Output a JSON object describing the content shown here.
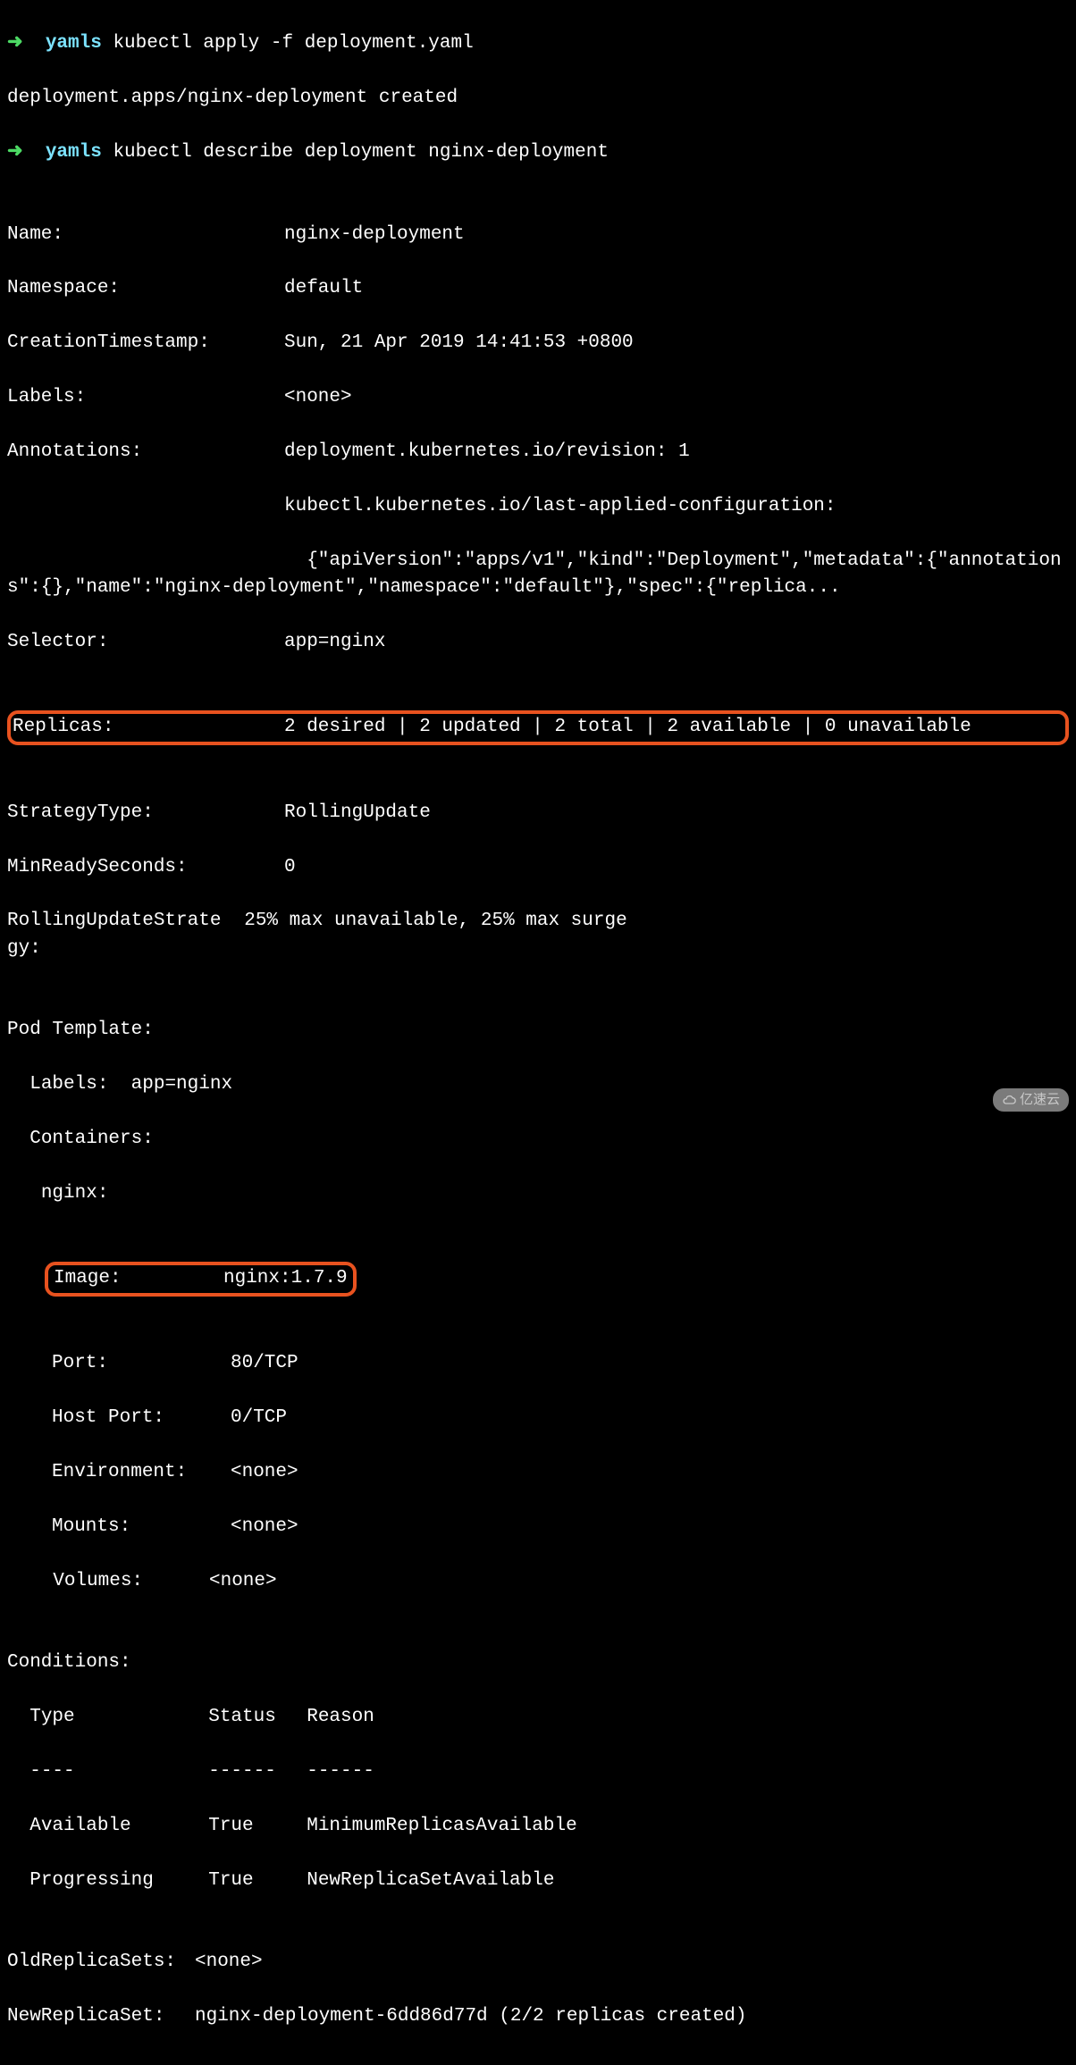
{
  "prompt1": {
    "arrow": "➜",
    "context": "yamls",
    "command": "kubectl apply -f deployment.yaml"
  },
  "out1": "deployment.apps/nginx-deployment created",
  "prompt2": {
    "arrow": "➜",
    "context": "yamls",
    "command": "kubectl describe deployment nginx-deployment"
  },
  "describe": {
    "Name": "nginx-deployment",
    "Namespace": "default",
    "CreationTimestamp": "Sun, 21 Apr 2019 14:41:53 +0800",
    "Labels": "<none>",
    "Annotations_line1": "deployment.kubernetes.io/revision: 1",
    "Annotations_line2": "kubectl.kubernetes.io/last-applied-configuration:",
    "Annotations_line3": "  {\"apiVersion\":\"apps/v1\",\"kind\":\"Deployment\",\"metadata\":{\"annotations\":{},\"name\":\"nginx-deployment\",\"namespace\":\"default\"},\"spec\":{\"replica...",
    "Selector": "app=nginx",
    "Replicas": "2 desired | 2 updated | 2 total | 2 available | 0 unavailable",
    "StrategyType": "RollingUpdate",
    "MinReadySeconds": "0",
    "RollingUpdateStrategy": "25% max unavailable, 25% max surge"
  },
  "pod_template": {
    "header": "Pod Template:",
    "labels_line": "  Labels:  app=nginx",
    "containers_header": "  Containers:",
    "container_name": "   nginx:",
    "Image": "nginx:1.7.9",
    "Port": "80/TCP",
    "HostPort": "0/TCP",
    "Environment": "<none>",
    "Mounts": "<none>",
    "Volumes_key": "  Volumes:",
    "Volumes_val": "<none>"
  },
  "conditions": {
    "header": "Conditions:",
    "cols": {
      "c1": "Type",
      "c2": "Status",
      "c3": "Reason"
    },
    "div": {
      "c1": "----",
      "c2": "------",
      "c3": "------"
    },
    "r1": {
      "c1": "Available",
      "c2": "True",
      "c3": "MinimumReplicasAvailable"
    },
    "r2": {
      "c1": "Progressing",
      "c2": "True",
      "c3": "NewReplicaSetAvailable"
    }
  },
  "rs": {
    "OldReplicaSets": "<none>",
    "NewReplicaSet": "nginx-deployment-6dd86d77d (2/2 replicas created)"
  },
  "watermark": "亿速云"
}
